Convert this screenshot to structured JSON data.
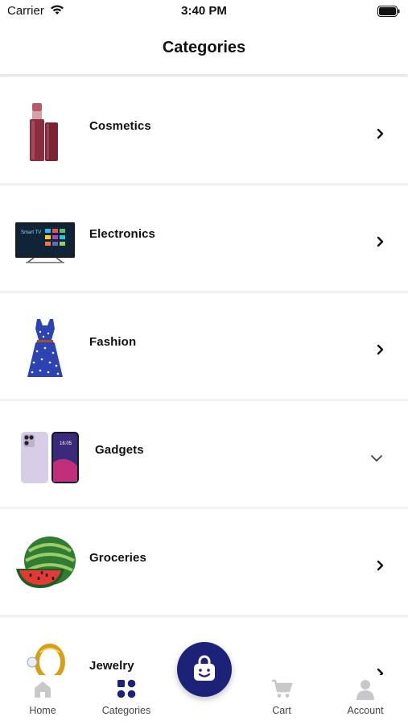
{
  "status_bar": {
    "carrier": "Carrier",
    "time": "3:40 PM",
    "wifi_icon": "wifi-icon",
    "battery_icon": "battery-icon"
  },
  "header": {
    "title": "Categories"
  },
  "categories": [
    {
      "label": "Cosmetics",
      "thumbnail": "lipstick",
      "indicator": "chevron-right"
    },
    {
      "label": "Electronics",
      "thumbnail": "smart-tv",
      "indicator": "chevron-right"
    },
    {
      "label": "Fashion",
      "thumbnail": "dress",
      "indicator": "chevron-right"
    },
    {
      "label": "Gadgets",
      "thumbnail": "smartphones",
      "indicator": "chevron-down"
    },
    {
      "label": "Groceries",
      "thumbnail": "watermelon",
      "indicator": "chevron-right"
    },
    {
      "label": "Jewelry",
      "thumbnail": "gold-ring",
      "indicator": "chevron-right"
    }
  ],
  "tab_bar": {
    "items": [
      {
        "label": "Home",
        "icon": "home-icon",
        "active": false
      },
      {
        "label": "Categories",
        "icon": "grid-icon",
        "active": true
      },
      {
        "label": "Cart",
        "icon": "cart-icon",
        "active": false
      },
      {
        "label": "Account",
        "icon": "account-icon",
        "active": false
      }
    ],
    "fab_icon": "shopping-bag-icon"
  },
  "colors": {
    "accent": "#1c2278",
    "inactive_icon": "#c8c8cc",
    "background": "#f2f2f5"
  }
}
